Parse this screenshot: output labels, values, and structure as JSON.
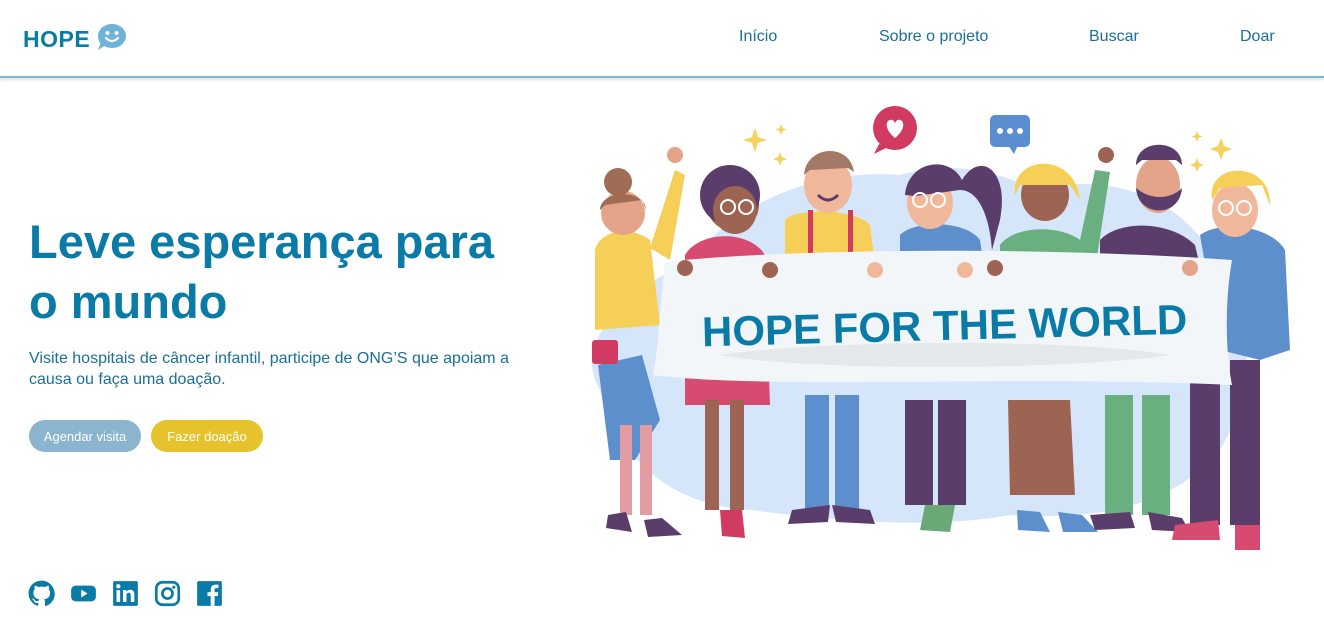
{
  "header": {
    "logo_text": "HOPE",
    "nav": [
      {
        "label": "Início"
      },
      {
        "label": "Sobre o projeto"
      },
      {
        "label": "Buscar"
      },
      {
        "label": "Doar"
      }
    ]
  },
  "hero": {
    "title_line1": "Leve esperança para",
    "title_line2": "o mundo",
    "subtitle": "Visite hospitais de câncer infantil, participe de ONG’S que apoiam a causa ou faça uma doação.",
    "buttons": {
      "visit": "Agendar visita",
      "donate": "Fazer doação"
    }
  },
  "illustration": {
    "banner_text": "HOPE FOR THE WORLD"
  },
  "socials": [
    {
      "icon": "github-icon"
    },
    {
      "icon": "youtube-icon"
    },
    {
      "icon": "linkedin-icon"
    },
    {
      "icon": "instagram-icon"
    },
    {
      "icon": "facebook-icon"
    }
  ],
  "colors": {
    "brand": "#0a7ba6",
    "nav_text": "#1a6f98",
    "button_visit": "#8bb4cf",
    "button_donate": "#e6c22d"
  }
}
